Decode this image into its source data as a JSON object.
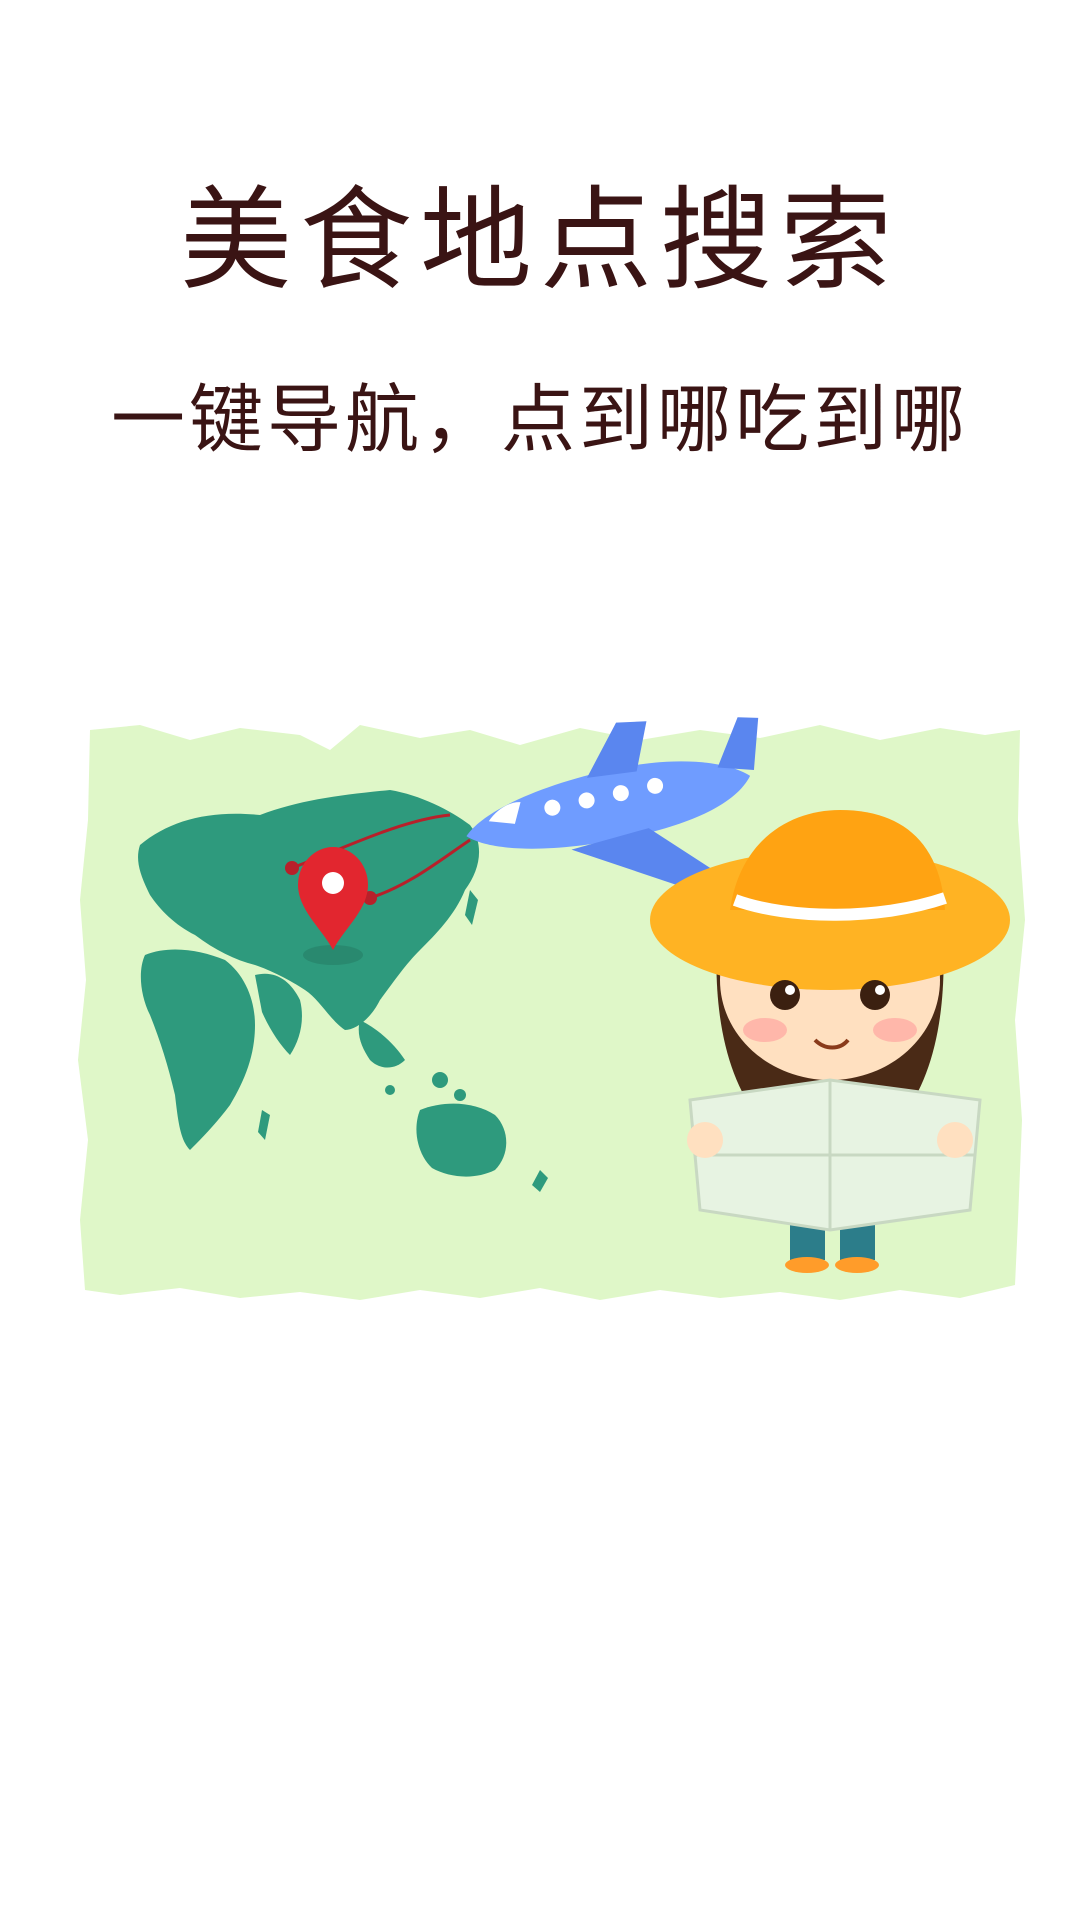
{
  "header": {
    "title": "美食地点搜索",
    "subtitle": "一键导航，点到哪吃到哪"
  },
  "illustration": {
    "name": "world-map-travel-illustration",
    "icons": [
      "world-map",
      "location-pin-icon",
      "airplane-icon",
      "traveler-girl",
      "paper-map"
    ],
    "colors": {
      "map_background": "#dff7c8",
      "continents": "#2e9a7d",
      "pin": "#e2262f",
      "airplane": "#6f9cff",
      "hat": "#ffb323"
    }
  }
}
